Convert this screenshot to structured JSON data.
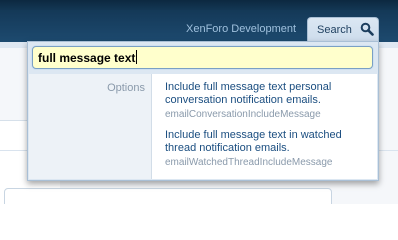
{
  "nav": {
    "link_label": "XenForo Development",
    "search_tab_label": "Search",
    "search_tab_icon": "magnifier-icon"
  },
  "search": {
    "query": "full message text"
  },
  "results": {
    "section_label": "Options",
    "items": [
      {
        "title_line1": "Include full message text personal",
        "title_line2": "conversation notification emails.",
        "option_id": "emailConversationIncludeMessage"
      },
      {
        "title_line1": "Include full message text in watched",
        "title_line2": "thread notification emails.",
        "option_id": "emailWatchedThreadIncludeMessage"
      }
    ]
  },
  "colors": {
    "navbar": "#173e5f",
    "input_bg": "#ffffcc",
    "link": "#1b4e80",
    "muted": "#8a9aab"
  }
}
